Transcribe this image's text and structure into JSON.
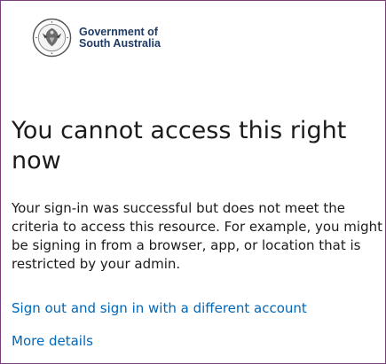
{
  "logo": {
    "line1": "Government of",
    "line2": "South Australia",
    "icon": "sa-government-crest-icon"
  },
  "page": {
    "title": "You cannot access this right now",
    "message": "Your sign-in was successful but does not meet the criteria to access this resource. For example, you might be signing in from a browser, app, or location that is restricted by your admin."
  },
  "links": {
    "sign_out": "Sign out and sign in with a different account",
    "more_details": "More details"
  },
  "colors": {
    "link": "#0067b8",
    "brand_text": "#1f3b63",
    "border": "#7a3e7e",
    "text": "#1b1b1b"
  }
}
